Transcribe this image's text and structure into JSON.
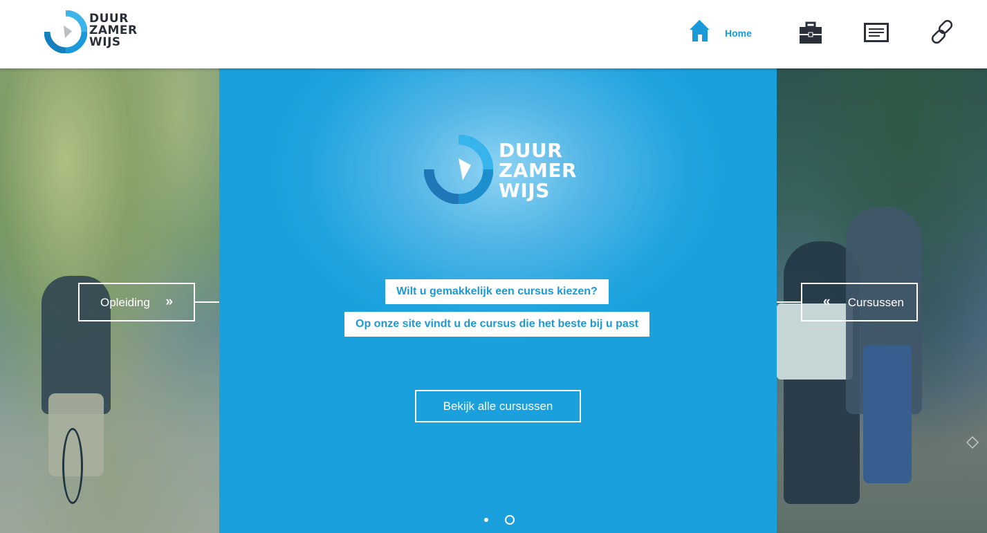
{
  "brand": {
    "logo_lines": [
      "DUUR",
      "ZAMER",
      "WIJS"
    ],
    "primary_color": "#1a9ad9",
    "dark_color": "#2a2f3a"
  },
  "nav": {
    "home_label": "Home",
    "home_icon": "home-icon",
    "portfolio_icon": "briefcase-icon",
    "news_icon": "document-icon",
    "links_icon": "link-icon"
  },
  "hero": {
    "left_button_label": "Opleiding",
    "left_button_chevron": "»",
    "right_button_label": "Cursussen",
    "right_button_chevron": "«",
    "tagline_1": "Wilt u gemakkelijk een cursus kiezen?",
    "tagline_2": "Op onze site vindt u de cursus die het beste bij u past",
    "cta_label": "Bekijk alle cursussen",
    "slide_count": 2,
    "active_slide": 1
  }
}
